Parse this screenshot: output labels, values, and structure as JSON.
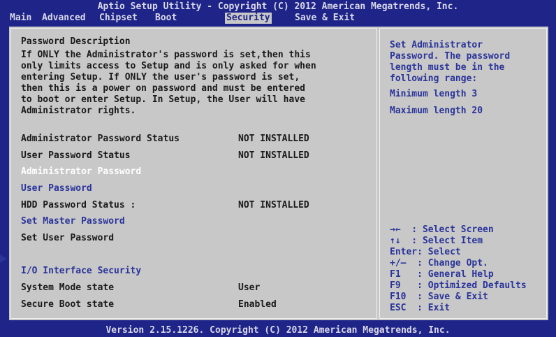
{
  "header": {
    "title": "Aptio Setup Utility - Copyright (C) 2012 American Megatrends, Inc."
  },
  "menu": [
    {
      "label": "Main"
    },
    {
      "label": "Advanced"
    },
    {
      "label": "Chipset"
    },
    {
      "label": "Boot"
    },
    {
      "label": "Security"
    },
    {
      "label": "Save & Exit"
    }
  ],
  "description": {
    "title": "Password Description",
    "lines": [
      "If ONLY the Administrator's password is set,then this",
      "only limits access to Setup and is only asked for when",
      "entering Setup. If ONLY the user's password is set,",
      "then this is a power on password and must be entered",
      "to boot or enter Setup. In Setup, the User will have",
      "Administrator rights."
    ]
  },
  "items": {
    "admin_status_label": "Administrator Password Status",
    "admin_status_value": "NOT INSTALLED",
    "user_status_label": "User Password Status",
    "user_status_value": "NOT INSTALLED",
    "admin_password": "Administrator Password",
    "user_password": "User Password",
    "hdd_status_label": "HDD Password Status :",
    "hdd_status_value": "NOT INSTALLED",
    "set_master_password": "Set Master Password",
    "set_user_password": "Set User Password",
    "io_interface_security": "I/O Interface Security",
    "system_mode_label": "System Mode state",
    "system_mode_value": "User",
    "secure_boot_label": "Secure Boot state",
    "secure_boot_value": "Enabled"
  },
  "help": {
    "lines": [
      "Set Administrator",
      "Password. The password",
      "length must be in the",
      "following range:"
    ],
    "min_length": "Minimum length 3",
    "max_length": "Maximum length 20",
    "keys": [
      "→←  : Select Screen",
      "↑↓  : Select Item",
      "Enter: Select",
      "+/—  : Change Opt.",
      "F1   : General Help",
      "F9   : Optimized Defaults",
      "F10  : Save & Exit",
      "ESC  : Exit"
    ]
  },
  "footer": {
    "text": "Version 2.15.1226. Copyright (C) 2012 American Megatrends, Inc."
  }
}
